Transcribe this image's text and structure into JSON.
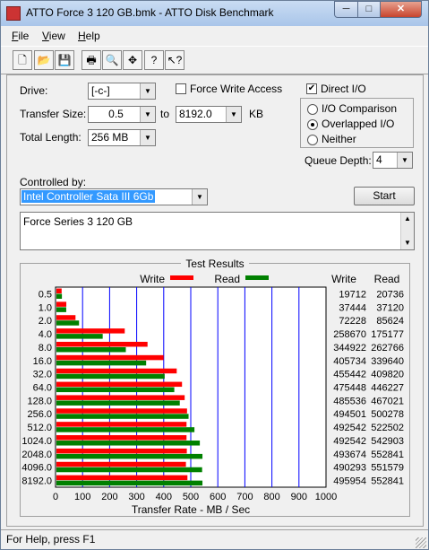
{
  "window": {
    "title": "ATTO Force 3 120 GB.bmk - ATTO Disk Benchmark"
  },
  "titlebar_buttons": {
    "minimize": "─",
    "maximize": "□",
    "close": "✕"
  },
  "menu": [
    {
      "label": "File",
      "accel": "F",
      "rest": "ile"
    },
    {
      "label": "View",
      "accel": "V",
      "rest": "iew"
    },
    {
      "label": "Help",
      "accel": "H",
      "rest": "elp"
    }
  ],
  "toolbar": {
    "icons": [
      "new-icon",
      "open-icon",
      "save-icon",
      "print-icon",
      "print-preview-icon",
      "move-icon",
      "help-icon",
      "context-help-icon"
    ],
    "glyphs": [
      "🗋",
      "📂",
      "💾",
      "🖶",
      "🔍",
      "✥",
      "?",
      "↖?"
    ]
  },
  "form": {
    "drive_label": "Drive:",
    "drive_value": "[-c-]",
    "force_write_label": "Force Write Access",
    "force_write_checked": false,
    "direct_io_label": "Direct I/O",
    "direct_io_checked": true,
    "transfer_size_label": "Transfer Size:",
    "transfer_from": "0.5",
    "to_label": "to",
    "transfer_to": "8192.0",
    "kb_label": "KB",
    "total_length_label": "Total Length:",
    "total_length_value": "256 MB",
    "io_options": [
      {
        "label": "I/O Comparison",
        "selected": false
      },
      {
        "label": "Overlapped I/O",
        "selected": true
      },
      {
        "label": "Neither",
        "selected": false
      }
    ],
    "queue_depth_label": "Queue Depth:",
    "queue_depth_value": "4",
    "controlled_by_label": "Controlled by:",
    "controller_value": "Intel Controller Sata III 6Gb",
    "start_label": "Start",
    "description": "Force Series 3 120 GB"
  },
  "results": {
    "title": "Test Results",
    "write_legend": "Write",
    "read_legend": "Read",
    "write_col": "Write",
    "read_col": "Read",
    "xlabel": "Transfer Rate - MB / Sec",
    "colors": {
      "write": "#ff0000",
      "read": "#008000",
      "grid": "#0000ff"
    }
  },
  "chart_data": {
    "type": "bar",
    "title": "Test Results",
    "xlabel": "Transfer Rate - MB / Sec",
    "xlim": [
      0,
      1000
    ],
    "xticks": [
      "0",
      "100",
      "200",
      "300",
      "400",
      "500",
      "600",
      "700",
      "800",
      "900",
      "1000"
    ],
    "categories": [
      "0.5",
      "1.0",
      "2.0",
      "4.0",
      "8.0",
      "16.0",
      "32.0",
      "64.0",
      "128.0",
      "256.0",
      "512.0",
      "1024.0",
      "2048.0",
      "4096.0",
      "8192.0"
    ],
    "series": [
      {
        "name": "Write",
        "values": [
          19712,
          37444,
          72228,
          258670,
          344922,
          405734,
          455442,
          475448,
          485536,
          494501,
          492542,
          492542,
          493674,
          490293,
          495954
        ]
      },
      {
        "name": "Read",
        "values": [
          20736,
          37120,
          85624,
          175177,
          262766,
          339640,
          409820,
          446227,
          467021,
          500278,
          522502,
          542903,
          552841,
          551579,
          552841
        ]
      }
    ]
  },
  "status": {
    "text": "For Help, press F1"
  }
}
